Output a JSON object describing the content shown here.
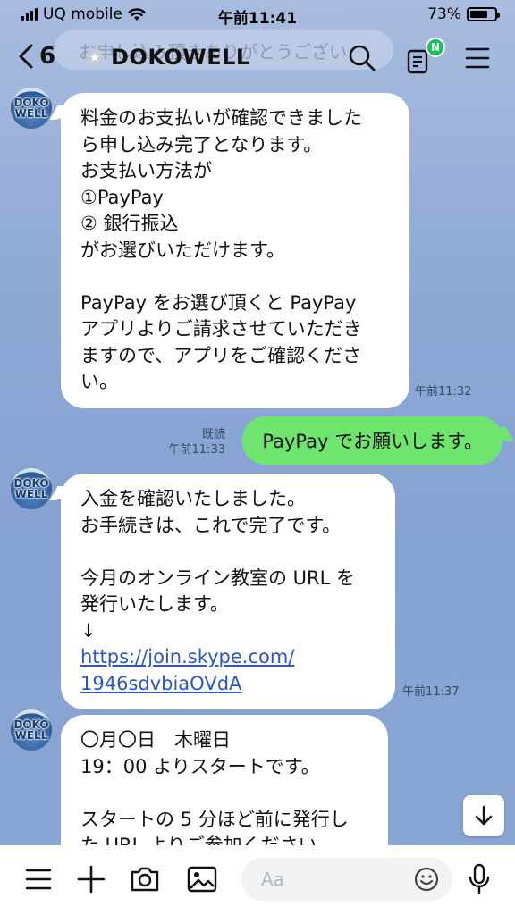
{
  "status": {
    "carrier": "UQ mobile",
    "time": "午前11:41",
    "battery_text": "73%",
    "battery_level": 0.73
  },
  "header": {
    "back_count": "6",
    "title": "DOKOWELL",
    "ghost_text": "お申し込み頂きありがとうござい",
    "notification_badge": "N"
  },
  "avatar": {
    "line1": "DOKO",
    "line2": "WELL"
  },
  "messages": {
    "m1": {
      "lines": [
        "料金のお支払いが確認できました",
        "ら申し込み完了となります。",
        "お支払い方法が",
        "①PayPay",
        "② 銀行振込",
        "がお選びいただけます。",
        "",
        "PayPay をお選び頂くと PayPay",
        "アプリよりご請求させていただき",
        "ますので、アプリをご確認くださ",
        "い。"
      ],
      "time": "午前11:32"
    },
    "m2": {
      "text": "PayPay でお願いします。",
      "read": "既読",
      "time": "午前11:33"
    },
    "m3": {
      "lines": [
        "入金を確認いたしました。",
        "お手続きは、これで完了です。",
        "",
        "今月のオンライン教室の URL を",
        "発行いたします。",
        "↓"
      ],
      "link1": "https://join.skype.com/",
      "link2": "1946sdvbiaOVdA",
      "time": "午前11:37"
    },
    "m4": {
      "lines": [
        "〇月〇日　木曜日",
        "19：00 よりスタートです。",
        "",
        "スタートの 5 分ほど前に発行し",
        "た URL よりご参加ください。"
      ]
    }
  },
  "input": {
    "placeholder": "Aa"
  },
  "colors": {
    "background": "#8fa9d6",
    "outgoing_bubble": "#6ee66e",
    "incoming_bubble": "#ffffff",
    "badge": "#19c15a",
    "link": "#2a56c6"
  }
}
